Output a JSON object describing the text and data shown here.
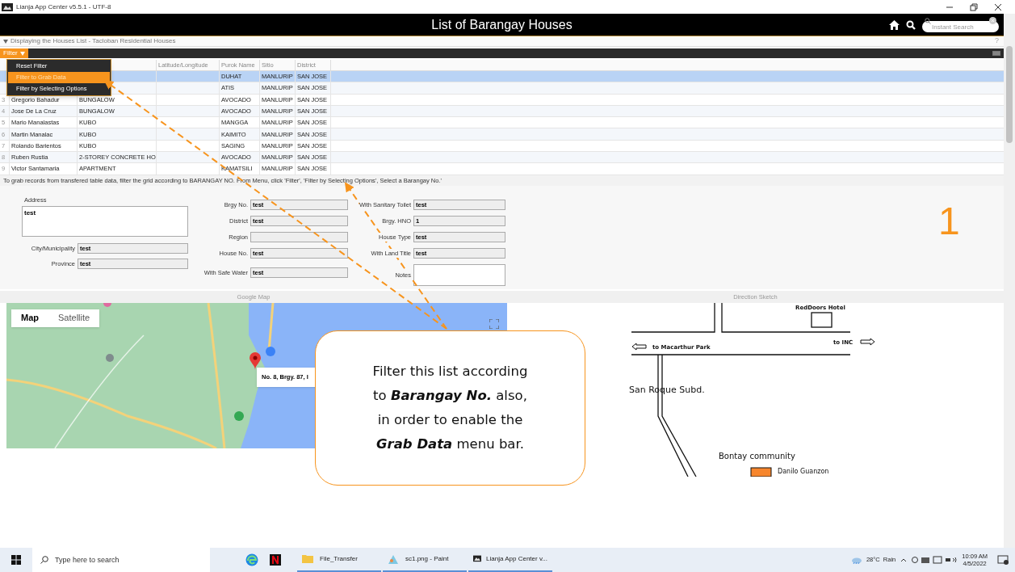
{
  "window": {
    "title": "Lianja App Center v5.5.1 - UTF-8"
  },
  "header": {
    "title": "List of Barangay Houses",
    "search": {
      "placeholder": "Instant Search"
    }
  },
  "subheader": {
    "text": "Displaying the Houses List - Tacloban Residential Houses",
    "help": "?"
  },
  "filter": {
    "label": "Filter",
    "menu": [
      {
        "label": "Reset Filter",
        "selected": false
      },
      {
        "label": "Filter to Grab Data",
        "selected": true
      },
      {
        "label": "Filter by Selecting Options",
        "selected": false
      }
    ]
  },
  "table": {
    "columns": [
      "Latitude/Longitude",
      "Purok Name",
      "Sitio",
      "District"
    ],
    "rows": [
      {
        "no": "",
        "name": "",
        "type": "",
        "latlong": "",
        "purok": "DUHAT",
        "sitio": "MANLURIP",
        "district": "SAN JOSE",
        "selected": true
      },
      {
        "no": "",
        "name": "",
        "type": "",
        "latlong": "",
        "purok": "ATIS",
        "sitio": "MANLURIP",
        "district": "SAN JOSE",
        "selected": false
      },
      {
        "no": "3",
        "name": "Gregorio Bahadur",
        "type": "BUNGALOW",
        "latlong": "",
        "purok": "AVOCADO",
        "sitio": "MANLURIP",
        "district": "SAN JOSE",
        "selected": false
      },
      {
        "no": "4",
        "name": "Jose De La Cruz",
        "type": "BUNGALOW",
        "latlong": "",
        "purok": "AVOCADO",
        "sitio": "MANLURIP",
        "district": "SAN JOSE",
        "selected": false
      },
      {
        "no": "5",
        "name": "Mario Manalastas",
        "type": "KUBO",
        "latlong": "",
        "purok": "MANGGA",
        "sitio": "MANLURIP",
        "district": "SAN JOSE",
        "selected": false
      },
      {
        "no": "6",
        "name": "Martin Manalac",
        "type": "KUBO",
        "latlong": "",
        "purok": "KAIMITO",
        "sitio": "MANLURIP",
        "district": "SAN JOSE",
        "selected": false
      },
      {
        "no": "7",
        "name": "Rolando Barientos",
        "type": "KUBO",
        "latlong": "",
        "purok": "SAGING",
        "sitio": "MANLURIP",
        "district": "SAN JOSE",
        "selected": false
      },
      {
        "no": "8",
        "name": "Ruben Rustia",
        "type": "2-STOREY CONCRETE HO",
        "latlong": "",
        "purok": "AVOCADO",
        "sitio": "MANLURIP",
        "district": "SAN JOSE",
        "selected": false
      },
      {
        "no": "9",
        "name": "Victor Santamaria",
        "type": "APARTMENT",
        "latlong": "",
        "purok": "KAMATSILI",
        "sitio": "MANLURIP",
        "district": "SAN JOSE",
        "selected": false
      }
    ]
  },
  "hint": "To grab records from transfered table data, filter the grid according to BARANGAY NO. From Menu, click 'Filter', 'Filter by Selecting Options', Select a Barangay No.'",
  "form": {
    "address": {
      "label": "Address",
      "value": "test"
    },
    "left": [
      {
        "label": "City/Municipality",
        "value": "test"
      },
      {
        "label": "Province",
        "value": "test"
      }
    ],
    "middle": [
      {
        "label": "Brgy No.",
        "value": "test"
      },
      {
        "label": "District",
        "value": "test"
      },
      {
        "label": "Region"
      },
      {
        "label": "House No.",
        "value": "test"
      },
      {
        "label": "With Safe Water",
        "value": "test"
      }
    ],
    "right": [
      {
        "label": "With Sanitary Toilet",
        "value": "test"
      },
      {
        "label": "Brgy. HNO",
        "value": "1"
      },
      {
        "label": "House Type",
        "value": "test"
      },
      {
        "label": "With Land Title",
        "value": "test"
      }
    ],
    "notes": {
      "label": "Notes"
    },
    "page_number": "1"
  },
  "map": {
    "title": "Google Map",
    "types": [
      {
        "label": "Map",
        "selected": true
      },
      {
        "label": "Satellite",
        "selected": false
      }
    ],
    "popup": "No. 8, Brgy. 87, I"
  },
  "sketch": {
    "title": "Direction Sketch",
    "labels": [
      "RedDoors Hotel",
      "to Macarthur Park",
      "to INC",
      "San Roque Subd.",
      "Bontay community",
      "Danilo Guanzon"
    ]
  },
  "callout": {
    "text": "Filter this list according\nto **Barangay No.** also,\nin order  to enable the\n**Grab Data** menu bar."
  },
  "taskbar": {
    "search": {
      "placeholder": "Type here to search"
    },
    "apps": [
      {
        "label": "File_Transfer",
        "kind": "folder"
      },
      {
        "label": "sc1.png - Paint",
        "kind": "paint"
      },
      {
        "label": "Lianja App Center v...",
        "kind": "lianja"
      }
    ],
    "weather": "28°C  Rain",
    "time": "10:09 AM",
    "date": "4/5/2022"
  }
}
